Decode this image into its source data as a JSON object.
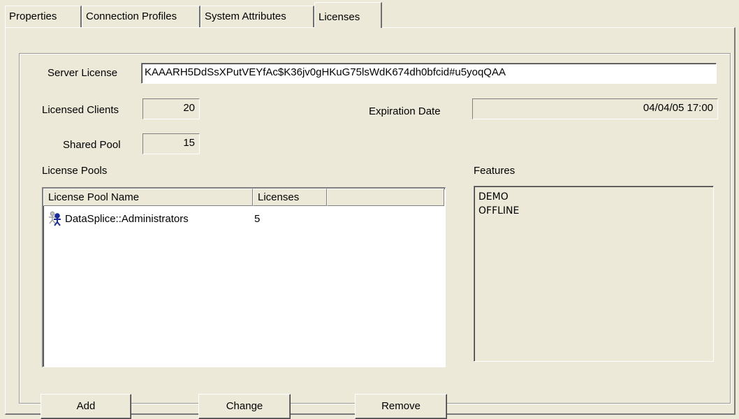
{
  "tabs": [
    {
      "label": "Properties",
      "active": false
    },
    {
      "label": "Connection Profiles",
      "active": false
    },
    {
      "label": "System Attributes",
      "active": false
    },
    {
      "label": "Licenses",
      "active": true
    }
  ],
  "server_license": {
    "label": "Server License",
    "value": "KAAARH5DdSsXPutVEYfAc$K36jv0gHKuG75lsWdK674dh0bfcid#u5yoqQAA"
  },
  "licensed_clients": {
    "label": "Licensed Clients",
    "value": "20"
  },
  "expiration_date": {
    "label": "Expiration Date",
    "value": "04/04/05 17:00"
  },
  "shared_pool": {
    "label": "Shared Pool",
    "value": "15"
  },
  "license_pools": {
    "label": "License Pools",
    "columns": [
      "License Pool Name",
      "Licenses"
    ],
    "rows": [
      {
        "icon": "user-group-icon",
        "name": "DataSplice::Administrators",
        "licenses": "5"
      }
    ]
  },
  "features": {
    "label": "Features",
    "items": [
      "DEMO",
      "OFFLINE"
    ]
  },
  "buttons": {
    "add": "Add",
    "change": "Change",
    "remove": "Remove"
  }
}
